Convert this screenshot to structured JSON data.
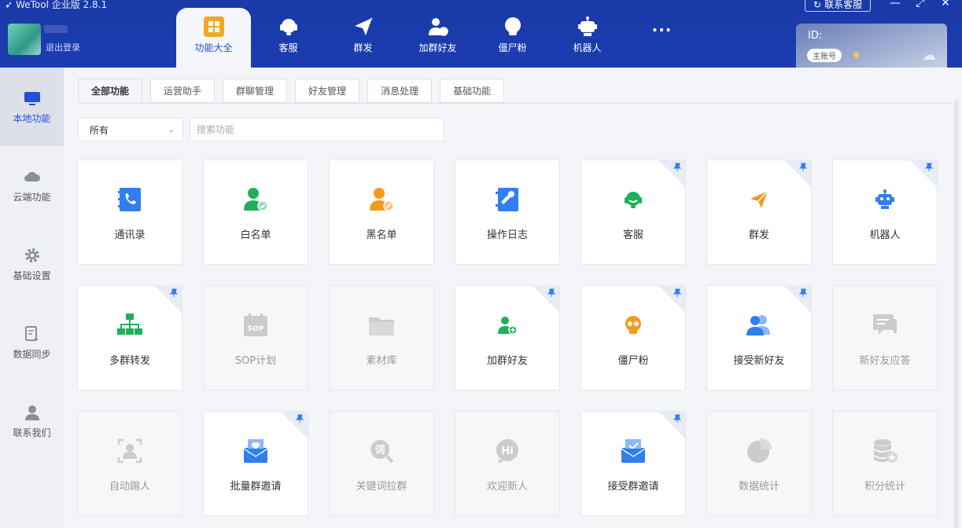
{
  "app": {
    "title": "WeTool 企业版 2.8.1",
    "logout": "退出登录"
  },
  "nav": [
    {
      "label": "功能大全",
      "icon": "grid-icon",
      "active": true
    },
    {
      "label": "客服",
      "icon": "headset-icon"
    },
    {
      "label": "群发",
      "icon": "send-icon"
    },
    {
      "label": "加群好友",
      "icon": "add-user-icon"
    },
    {
      "label": "僵尸粉",
      "icon": "skull-icon"
    },
    {
      "label": "机器人",
      "icon": "robot-icon"
    },
    {
      "label": "···",
      "icon": "more-icon"
    }
  ],
  "header": {
    "contact": "联系客服",
    "account_id": "ID:",
    "account_badge": "主账号"
  },
  "sidebar": [
    {
      "label": "本地功能",
      "icon": "monitor-icon",
      "active": true
    },
    {
      "label": "云端功能",
      "icon": "cloud-icon"
    },
    {
      "label": "基础设置",
      "icon": "gear-icon"
    },
    {
      "label": "数据同步",
      "icon": "sync-doc-icon"
    },
    {
      "label": "联系我们",
      "icon": "person-icon"
    }
  ],
  "tabs": [
    "全部功能",
    "运营助手",
    "群聊管理",
    "好友管理",
    "消息处理",
    "基础功能"
  ],
  "filter": {
    "selected": "所有",
    "search_placeholder": "搜索功能"
  },
  "cards": [
    {
      "label": "通讯录",
      "icon": "contacts-icon",
      "color": "#2f7ff0",
      "pinned": false,
      "enabled": true
    },
    {
      "label": "白名单",
      "icon": "whitelist-icon",
      "color": "#1fb05a",
      "pinned": false,
      "enabled": true
    },
    {
      "label": "黑名单",
      "icon": "blacklist-icon",
      "color": "#f39a1e",
      "pinned": false,
      "enabled": true
    },
    {
      "label": "操作日志",
      "icon": "log-icon",
      "color": "#2f7ff0",
      "pinned": false,
      "enabled": true
    },
    {
      "label": "客服",
      "icon": "headset-icon",
      "color": "#1fb05a",
      "pinned": true,
      "enabled": true
    },
    {
      "label": "群发",
      "icon": "send-icon",
      "color": "#f39a1e",
      "pinned": true,
      "enabled": true
    },
    {
      "label": "机器人",
      "icon": "robot-icon",
      "color": "#2f7ff0",
      "pinned": true,
      "enabled": true
    },
    {
      "label": "多群转发",
      "icon": "org-chart-icon",
      "color": "#1fb05a",
      "pinned": true,
      "enabled": true
    },
    {
      "label": "SOP计划",
      "icon": "sop-icon",
      "color": "#cccccc",
      "pinned": false,
      "enabled": false
    },
    {
      "label": "素材库",
      "icon": "folder-icon",
      "color": "#cccccc",
      "pinned": false,
      "enabled": false
    },
    {
      "label": "加群好友",
      "icon": "add-user-icon",
      "color": "#1fb05a",
      "pinned": true,
      "enabled": true
    },
    {
      "label": "僵尸粉",
      "icon": "skull-icon",
      "color": "#f39a1e",
      "pinned": true,
      "enabled": true
    },
    {
      "label": "接受新好友",
      "icon": "users-icon",
      "color": "#2f7ff0",
      "pinned": true,
      "enabled": true
    },
    {
      "label": "新好友应答",
      "icon": "chat-icon",
      "color": "#cccccc",
      "pinned": false,
      "enabled": false
    },
    {
      "label": "自动踢人",
      "icon": "kick-icon",
      "color": "#cccccc",
      "pinned": false,
      "enabled": false
    },
    {
      "label": "批量群邀请",
      "icon": "mail-heart-icon",
      "color": "#2f7ff0",
      "pinned": true,
      "enabled": true
    },
    {
      "label": "关键词拉群",
      "icon": "keyword-icon",
      "color": "#cccccc",
      "pinned": false,
      "enabled": false
    },
    {
      "label": "欢迎新人",
      "icon": "hi-icon",
      "color": "#cccccc",
      "pinned": false,
      "enabled": false
    },
    {
      "label": "接受群邀请",
      "icon": "mail-check-icon",
      "color": "#2f7ff0",
      "pinned": true,
      "enabled": true
    },
    {
      "label": "数据统计",
      "icon": "pie-icon",
      "color": "#cccccc",
      "pinned": false,
      "enabled": false
    },
    {
      "label": "积分统计",
      "icon": "database-icon",
      "color": "#cccccc",
      "pinned": false,
      "enabled": false
    }
  ],
  "colors": {
    "header": "#1b3cb0",
    "accent": "#2350d8"
  }
}
